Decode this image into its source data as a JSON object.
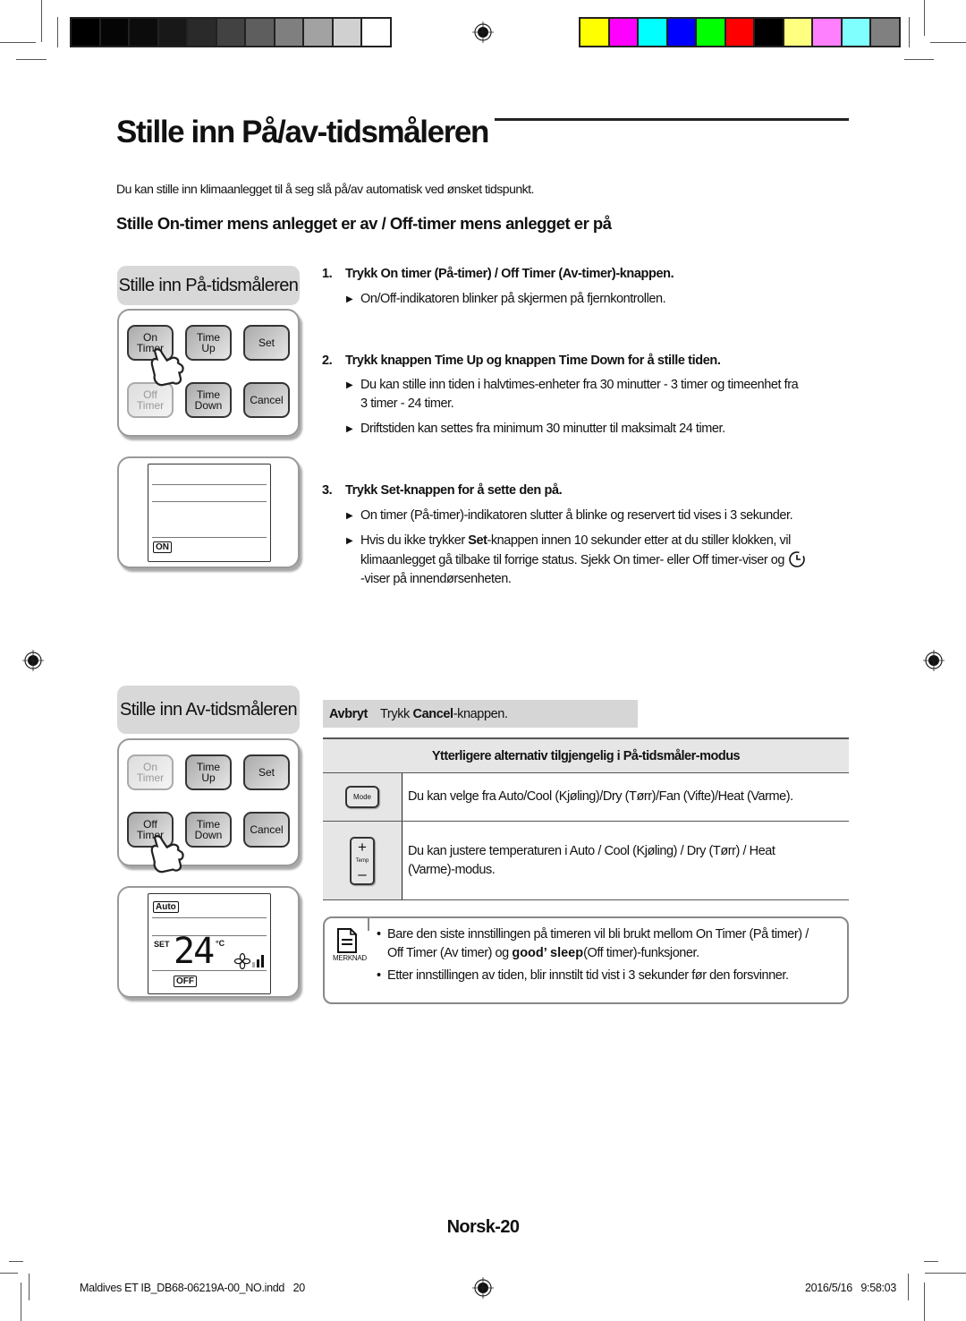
{
  "color_bars": {
    "grayscale": [
      "#000000",
      "#050505",
      "#0c0c0c",
      "#181818",
      "#2a2a2a",
      "#424242",
      "#5e5e5e",
      "#7f7f7f",
      "#a2a2a2",
      "#d0d0d0",
      "#ffffff"
    ],
    "colors": [
      "#ffff00",
      "#ff00ff",
      "#00ffff",
      "#0000ff",
      "#00ff00",
      "#ff0000",
      "#000000",
      "#ffff80",
      "#ff80ff",
      "#80ffff",
      "#808080"
    ]
  },
  "page": {
    "title": "Stille inn På/av-tidsmåleren",
    "intro": "Du kan stille inn klimaanlegget til å seg slå på/av automatisk ved ønsket tidspunkt.",
    "subheading": "Stille On-timer mens anlegget er av / Off-timer mens anlegget er på"
  },
  "on_timer_section": {
    "tag": "Stille inn På-tidsmåleren",
    "remote_buttons": [
      {
        "line1": "On",
        "line2": "Timer",
        "state": "pressed"
      },
      {
        "line1": "Time",
        "line2": "Up",
        "state": "normal"
      },
      {
        "line1": "Set",
        "line2": "",
        "state": "normal"
      },
      {
        "line1": "Off",
        "line2": "Timer",
        "state": "dimmed"
      },
      {
        "line1": "Time",
        "line2": "Down",
        "state": "normal"
      },
      {
        "line1": "Cancel",
        "line2": "",
        "state": "normal"
      }
    ],
    "display": {
      "indicator": "ON"
    }
  },
  "off_timer_section": {
    "tag": "Stille inn Av-tidsmåleren",
    "remote_buttons": [
      {
        "line1": "On",
        "line2": "Timer",
        "state": "dimmed"
      },
      {
        "line1": "Time",
        "line2": "Up",
        "state": "normal"
      },
      {
        "line1": "Set",
        "line2": "",
        "state": "normal"
      },
      {
        "line1": "Off",
        "line2": "Timer",
        "state": "pressed"
      },
      {
        "line1": "Time",
        "line2": "Down",
        "state": "normal"
      },
      {
        "line1": "Cancel",
        "line2": "",
        "state": "normal"
      }
    ],
    "display": {
      "mode": "Auto",
      "set_label": "SET",
      "temperature": "24",
      "unit": "°C",
      "indicator": "OFF"
    }
  },
  "steps": [
    {
      "number": "1.",
      "parts": [
        [
          "Trykk ",
          false
        ],
        [
          "On timer (På-timer) / Off Timer (Av-timer)",
          true
        ],
        [
          "-knappen.",
          false
        ]
      ],
      "bullets": [
        "On/Off-indikatoren blinker på skjermen på fjernkontrollen."
      ]
    },
    {
      "number": "2.",
      "parts": [
        [
          "Trykk knappen ",
          false
        ],
        [
          "Time Up",
          true
        ],
        [
          " og knappen ",
          false
        ],
        [
          "Time Down",
          true
        ],
        [
          " for å stille tiden.",
          false
        ]
      ],
      "bullets": [
        "Du kan stille inn tiden i halvtimes-enheter fra 30 minutter - 3 timer og timeenhet fra",
        "3 timer - 24 timer.",
        "Driftstiden kan settes fra minimum 30 minutter til maksimalt 24 timer."
      ]
    },
    {
      "number": "3.",
      "parts": [
        [
          "Trykk ",
          false
        ],
        [
          "Set",
          true
        ],
        [
          "-knappen for å sette den på.",
          false
        ]
      ],
      "bullets": [
        "On timer (På-timer)-indikatoren slutter å blinke og reservert tid vises i 3 sekunder.",
        "Hvis du ikke trykker ",
        "Set",
        "-knappen innen 10 sekunder etter at du stiller klokken, vil",
        "klimaanlegget gå tilbake til forrige status. Sjekk On timer- eller Off timer-viser og",
        "-viser på innendørsenheten."
      ]
    }
  ],
  "cancel": {
    "label": "Avbryt",
    "text_pre": "Trykk ",
    "text_bold": "Cancel",
    "text_post": "-knappen."
  },
  "options_table": {
    "header": "Ytterligere alternativ tilgjengelig i På-tidsmåler-modus",
    "rows": [
      {
        "icon": "mode-button-icon",
        "icon_label": "Mode",
        "text": "Du kan velge fra Auto/Cool (Kjøling)/Dry (Tørr)/Fan (Vifte)/Heat (Varme)."
      },
      {
        "icon": "temp-button-icon",
        "icon_label": "Temp",
        "text_line1": "Du kan justere temperaturen i Auto / Cool (Kjøling) / Dry (Tørr) / Heat",
        "text_line2": "(Varme)-modus."
      }
    ]
  },
  "note": {
    "label": "MERKNAD",
    "bullet1_line1": "Bare den siste innstillingen på timeren vil bli brukt mellom On Timer (På timer) /",
    "bullet1_line2_pre": "Off Timer (Av timer) og ",
    "bullet1_brand": "good’ sleep",
    "bullet1_line2_post": "(Off timer)-funksjoner.",
    "bullet2": "Etter innstillingen av tiden, blir innstilt tid vist i 3 sekunder før den forsvinner."
  },
  "footer": {
    "page_label": "Norsk-20",
    "file": "Maldives ET IB_DB68-06219A-00_NO.indd   20",
    "timestamp": "2016/5/16   9:58:03"
  }
}
